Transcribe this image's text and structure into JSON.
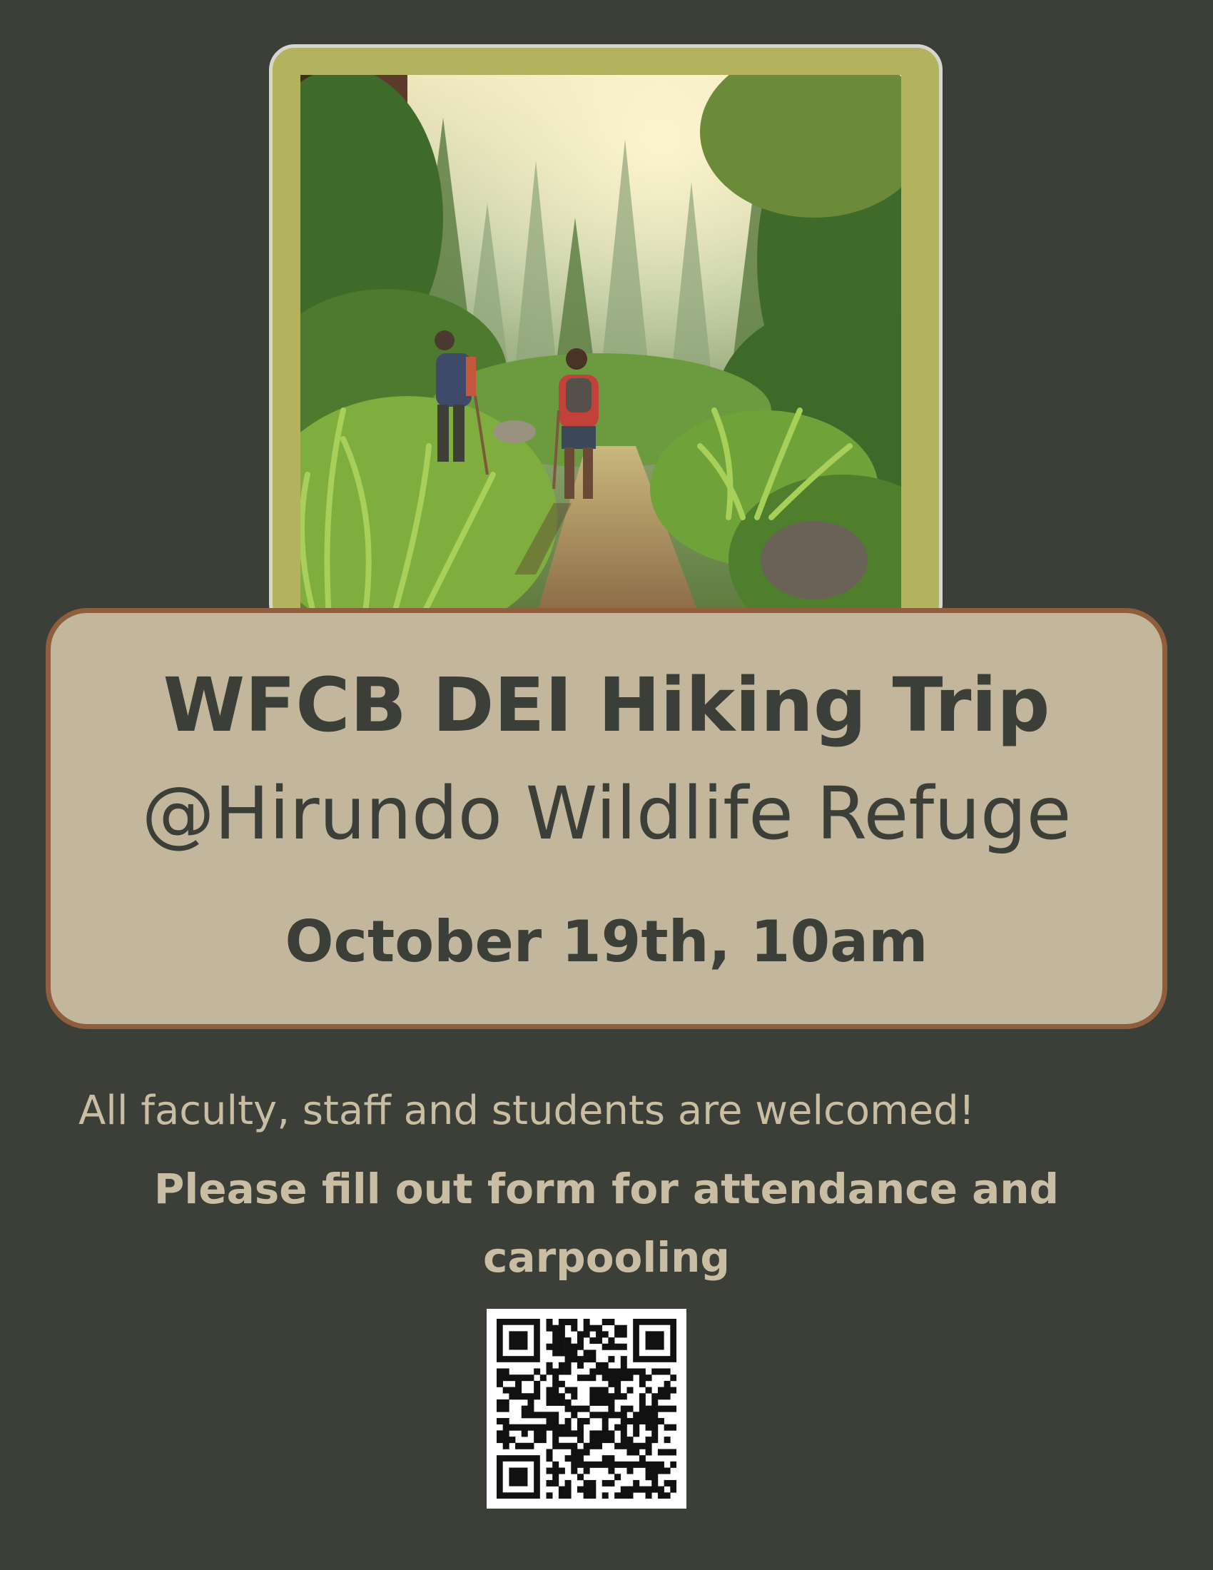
{
  "poster": {
    "title": "WFCB DEI Hiking Trip",
    "subtitle": "@Hirundo Wildlife Refuge",
    "date": "October 19th, 10am",
    "welcome": "All faculty, staff and students are welcomed!",
    "form_prompt": "Please fill out form for attendance and carpooling"
  },
  "colors": {
    "background": "#3b3f38",
    "frame": "#b3b25f",
    "banner": "#c2b79c",
    "banner_border": "#8f5e3c",
    "text_light": "#c9bea3",
    "text_dark": "#3b3f38"
  },
  "images": {
    "illustration": "two hikers on a forest trail",
    "qr_code": "qr-code"
  }
}
